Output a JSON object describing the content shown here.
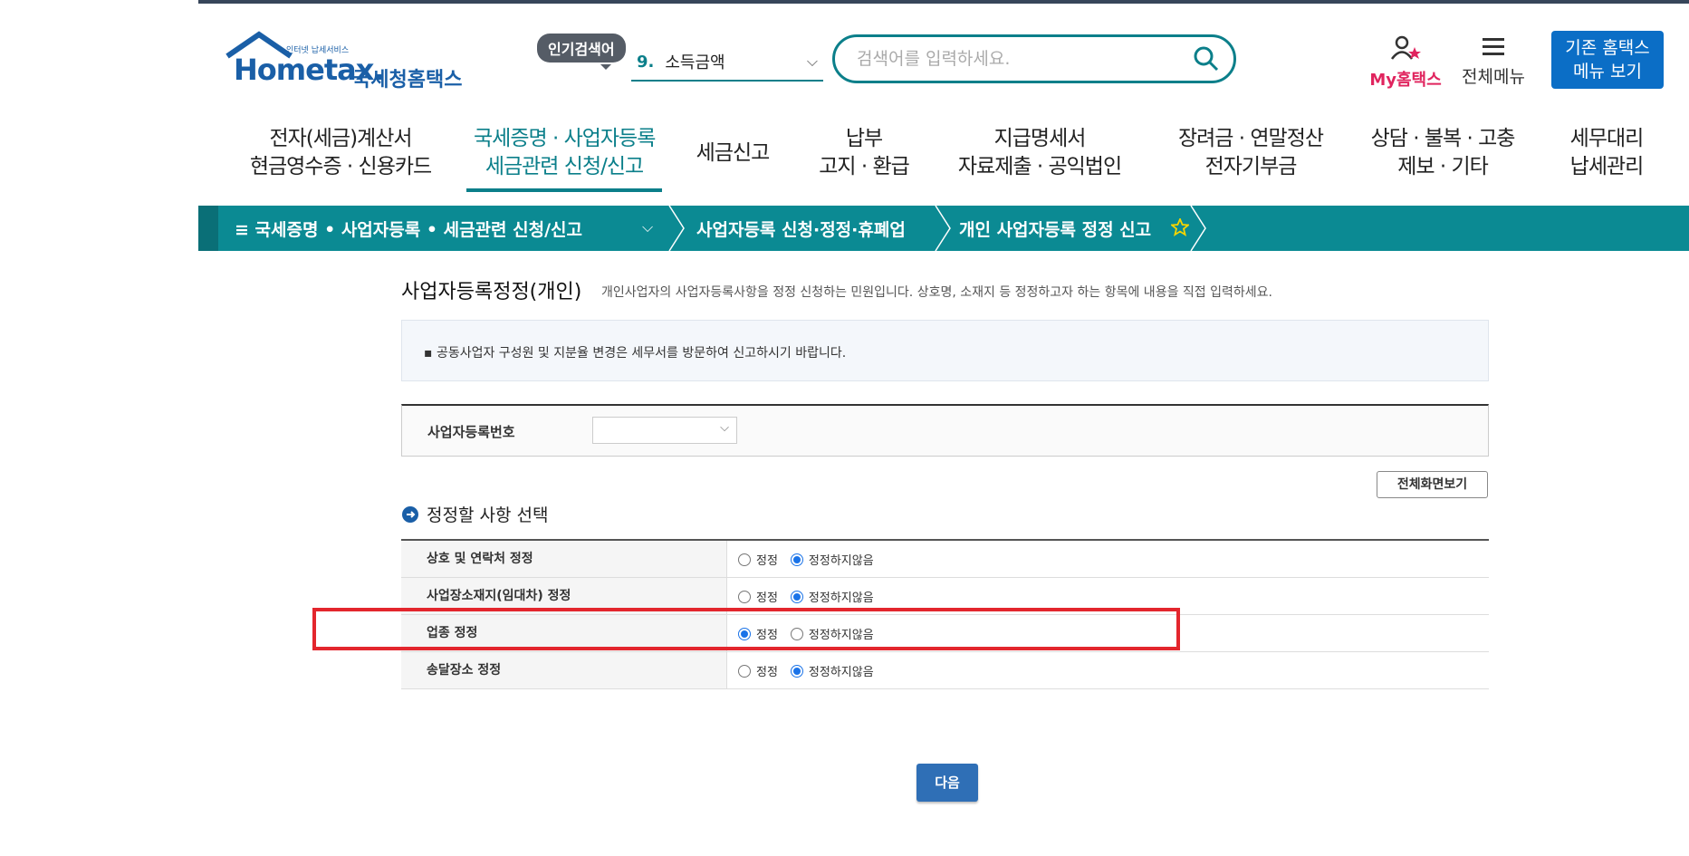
{
  "header": {
    "logo_small": "인터넷 납세서비스",
    "logo_main": "Hometax.",
    "logo_kr": "국세청홈택스",
    "popular_badge": "인기검색어",
    "popular_num": "9.",
    "popular_term": "소득금액",
    "search_placeholder": "검색어를 입력하세요.",
    "my_label": "My홈택스",
    "allmenu_label": "전체메뉴",
    "oldmenu_line1": "기존 홈택스",
    "oldmenu_line2": "메뉴 보기"
  },
  "nav": [
    {
      "l1": "전자(세금)계산서",
      "l2": "현금영수증 · 신용카드"
    },
    {
      "l1": "국세증명 · 사업자등록",
      "l2": "세금관련 신청/신고"
    },
    {
      "l1": "세금신고",
      "l2": ""
    },
    {
      "l1": "납부",
      "l2": "고지 · 환급"
    },
    {
      "l1": "지급명세서",
      "l2": "자료제출 · 공익법인"
    },
    {
      "l1": "장려금 · 연말정산",
      "l2": "전자기부금"
    },
    {
      "l1": "상담 · 불복 · 고충",
      "l2": "제보 · 기타"
    },
    {
      "l1": "세무대리",
      "l2": "납세관리"
    }
  ],
  "breadcrumb": {
    "menu": "≡  국세증명 • 사업자등록 • 세금관련 신청/신고",
    "level2": "사업자등록 신청·정정·휴폐업",
    "level3": "개인 사업자등록 정정 신고"
  },
  "page": {
    "title": "사업자등록정정(개인)",
    "subtitle": "개인사업자의 사업자등록사항을 정정 신청하는 민원입니다. 상호명, 소재지 등 정정하고자 하는 항목에 내용을 직접 입력하세요.",
    "notice": "공동사업자 구성원 및 지분율 변경은 세무서를 방문하여 신고하시기 바랍니다.",
    "reg_label": "사업자등록번호",
    "fullview": "전체화면보기",
    "section_title": "정정할 사항 선택",
    "opt_yes": "정정",
    "opt_no": "정정하지않음",
    "rows": [
      {
        "label": "상호 및 연락처 정정",
        "selected": "no"
      },
      {
        "label": "사업장소재지(임대차) 정정",
        "selected": "no"
      },
      {
        "label": "업종 정정",
        "selected": "yes"
      },
      {
        "label": "송달장소 정정",
        "selected": "no"
      }
    ],
    "next": "다음"
  },
  "colors": {
    "teal": "#0b8a93",
    "highlight": "#e3262d",
    "primary": "#2f6fb6"
  }
}
